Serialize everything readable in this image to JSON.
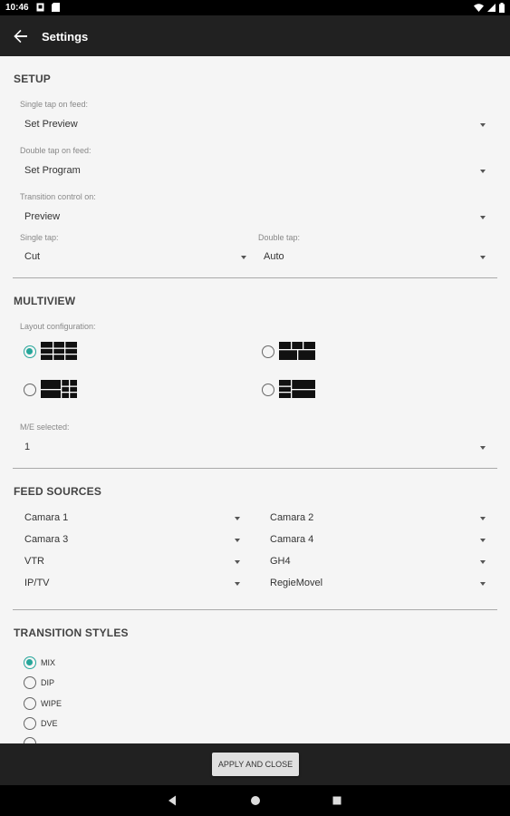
{
  "status": {
    "time": "10:46"
  },
  "toolbar": {
    "title": "Settings"
  },
  "setup": {
    "title": "SETUP",
    "single_tap_label": "Single tap on feed:",
    "single_tap_value": "Set Preview",
    "double_tap_label": "Double tap on feed:",
    "double_tap_value": "Set Program",
    "transition_label": "Transition control on:",
    "transition_value": "Preview",
    "single_tap2_label": "Single tap:",
    "single_tap2_value": "Cut",
    "double_tap2_label": "Double tap:",
    "double_tap2_value": "Auto"
  },
  "multiview": {
    "title": "MULTIVIEW",
    "layout_label": "Layout configuration:",
    "selected_layout": 0,
    "me_label": "M/E selected:",
    "me_value": "1"
  },
  "feeds": {
    "title": "FEED SOURCES",
    "left": [
      "Camara 1",
      "Camara 3",
      "VTR",
      "IP/TV"
    ],
    "right": [
      "Camara 2",
      "Camara 4",
      "GH4",
      "RegieMovel"
    ]
  },
  "transitions": {
    "title": "TRANSITION STYLES",
    "options": [
      "MIX",
      "DIP",
      "WIPE",
      "DVE"
    ],
    "selected": "MIX"
  },
  "bottom": {
    "apply_label": "APPLY AND CLOSE"
  },
  "colors": {
    "accent": "#26a69a",
    "toolbar": "#212121",
    "background": "#f5f5f5"
  }
}
